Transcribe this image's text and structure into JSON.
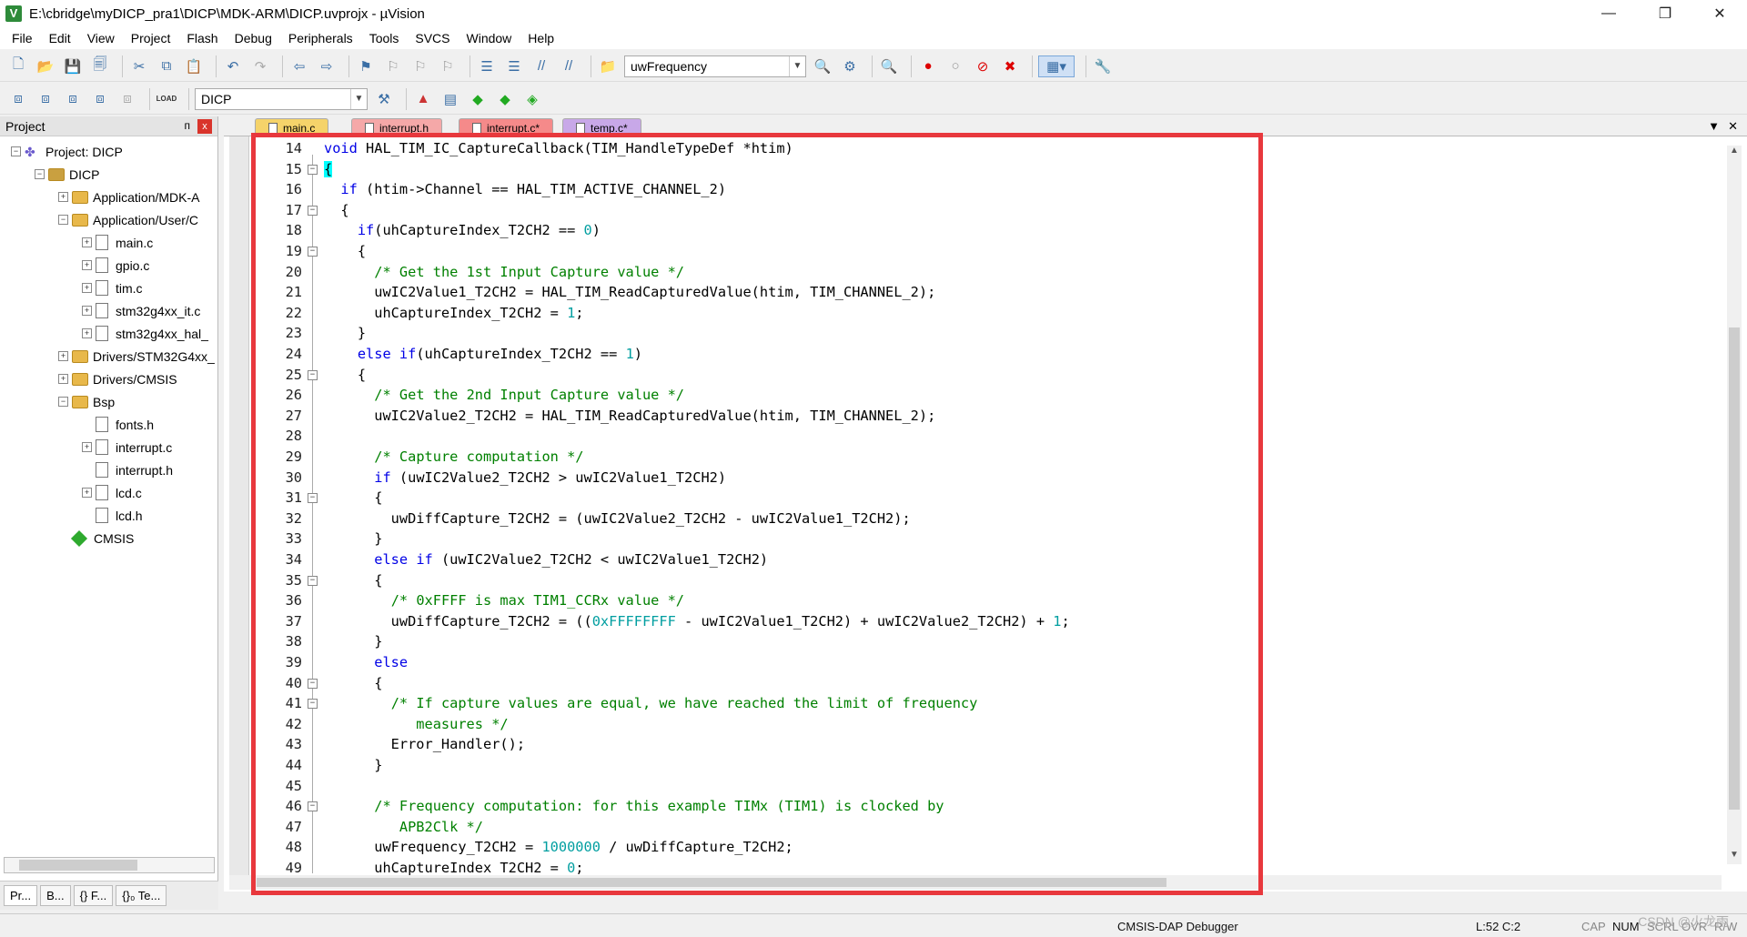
{
  "window": {
    "title": "E:\\cbridge\\myDICP_pra1\\DICP\\MDK-ARM\\DICP.uvprojx - µVision",
    "app_icon": "V",
    "controls": {
      "minimize": "—",
      "maximize": "❐",
      "close": "✕"
    }
  },
  "menu": [
    "File",
    "Edit",
    "View",
    "Project",
    "Flash",
    "Debug",
    "Peripherals",
    "Tools",
    "SVCS",
    "Window",
    "Help"
  ],
  "toolbar1": {
    "find_combo_value": "uwFrequency",
    "icons": [
      "new-file-icon",
      "open-icon",
      "save-icon",
      "save-all-icon",
      "cut-icon",
      "copy-icon",
      "paste-icon",
      "undo-icon",
      "redo-icon",
      "nav-back-icon",
      "nav-forward-icon",
      "bookmark-icon",
      "bookmark-prev-icon",
      "bookmark-next-icon",
      "bookmark-clear-icon",
      "indent-icon",
      "unindent-icon",
      "comment-icon",
      "uncomment-icon",
      "find-in-files-icon"
    ]
  },
  "toolbar2": {
    "target_combo_value": "DICP",
    "load_label": "LOAD"
  },
  "project_panel": {
    "title": "Project",
    "pin": "ᴨ",
    "close": "x",
    "tree": [
      {
        "label": "Project: DICP",
        "level": 0,
        "type": "project",
        "expander": "−"
      },
      {
        "label": "DICP",
        "level": 1,
        "type": "target",
        "expander": "−"
      },
      {
        "label": "Application/MDK-A",
        "level": 2,
        "type": "folder",
        "expander": "+"
      },
      {
        "label": "Application/User/C",
        "level": 2,
        "type": "folder",
        "expander": "−"
      },
      {
        "label": "main.c",
        "level": 3,
        "type": "file",
        "expander": "+"
      },
      {
        "label": "gpio.c",
        "level": 3,
        "type": "file",
        "expander": "+"
      },
      {
        "label": "tim.c",
        "level": 3,
        "type": "file",
        "expander": "+"
      },
      {
        "label": "stm32g4xx_it.c",
        "level": 3,
        "type": "file",
        "expander": "+"
      },
      {
        "label": "stm32g4xx_hal_",
        "level": 3,
        "type": "file",
        "expander": "+"
      },
      {
        "label": "Drivers/STM32G4xx_",
        "level": 2,
        "type": "folder",
        "expander": "+"
      },
      {
        "label": "Drivers/CMSIS",
        "level": 2,
        "type": "folder",
        "expander": "+"
      },
      {
        "label": "Bsp",
        "level": 2,
        "type": "folder",
        "expander": "−"
      },
      {
        "label": "fonts.h",
        "level": 3,
        "type": "file",
        "expander": ""
      },
      {
        "label": "interrupt.c",
        "level": 3,
        "type": "file",
        "expander": "+"
      },
      {
        "label": "interrupt.h",
        "level": 3,
        "type": "file",
        "expander": ""
      },
      {
        "label": "lcd.c",
        "level": 3,
        "type": "file",
        "expander": "+"
      },
      {
        "label": "lcd.h",
        "level": 3,
        "type": "file",
        "expander": ""
      },
      {
        "label": "CMSIS",
        "level": 2,
        "type": "cmsis",
        "expander": ""
      }
    ],
    "bottom_tabs": [
      "Pr...",
      "B...",
      "{} F...",
      "{}₀ Te..."
    ]
  },
  "editor_tabs": [
    {
      "label": "main.c",
      "color": "#f5d36a"
    },
    {
      "label": "interrupt.h",
      "color": "#f5a8a8"
    },
    {
      "label": "interrupt.c*",
      "color": "#f58a8a"
    },
    {
      "label": "temp.c*",
      "color": "#c8a8e8"
    }
  ],
  "code_lines": [
    {
      "n": "14",
      "fold": "",
      "html": "<span class=\"kw\">void</span> HAL_TIM_IC_CaptureCallback(TIM_HandleTypeDef *htim)"
    },
    {
      "n": "15",
      "fold": "−",
      "html": "<span class=\"brace-hl\">{</span>"
    },
    {
      "n": "16",
      "fold": "",
      "html": "  <span class=\"kw\">if</span> (htim->Channel == HAL_TIM_ACTIVE_CHANNEL_2)"
    },
    {
      "n": "17",
      "fold": "−",
      "html": "  {"
    },
    {
      "n": "18",
      "fold": "",
      "html": "    <span class=\"kw\">if</span>(uhCaptureIndex_T2CH2 == <span class=\"num\">0</span>)"
    },
    {
      "n": "19",
      "fold": "−",
      "html": "    {"
    },
    {
      "n": "20",
      "fold": "",
      "html": "      <span class=\"cm\">/* Get the 1st Input Capture value */</span>"
    },
    {
      "n": "21",
      "fold": "",
      "html": "      uwIC2Value1_T2CH2 = HAL_TIM_ReadCapturedValue(htim, TIM_CHANNEL_2);"
    },
    {
      "n": "22",
      "fold": "",
      "html": "      uhCaptureIndex_T2CH2 = <span class=\"num\">1</span>;"
    },
    {
      "n": "23",
      "fold": "",
      "html": "    }"
    },
    {
      "n": "24",
      "fold": "",
      "html": "    <span class=\"kw\">else if</span>(uhCaptureIndex_T2CH2 == <span class=\"num\">1</span>)"
    },
    {
      "n": "25",
      "fold": "−",
      "html": "    {"
    },
    {
      "n": "26",
      "fold": "",
      "html": "      <span class=\"cm\">/* Get the 2nd Input Capture value */</span>"
    },
    {
      "n": "27",
      "fold": "",
      "html": "      uwIC2Value2_T2CH2 = HAL_TIM_ReadCapturedValue(htim, TIM_CHANNEL_2);"
    },
    {
      "n": "28",
      "fold": "",
      "html": ""
    },
    {
      "n": "29",
      "fold": "",
      "html": "      <span class=\"cm\">/* Capture computation */</span>"
    },
    {
      "n": "30",
      "fold": "",
      "html": "      <span class=\"kw\">if</span> (uwIC2Value2_T2CH2 > uwIC2Value1_T2CH2)"
    },
    {
      "n": "31",
      "fold": "−",
      "html": "      {"
    },
    {
      "n": "32",
      "fold": "",
      "html": "        uwDiffCapture_T2CH2 = (uwIC2Value2_T2CH2 - uwIC2Value1_T2CH2);"
    },
    {
      "n": "33",
      "fold": "",
      "html": "      }"
    },
    {
      "n": "34",
      "fold": "",
      "html": "      <span class=\"kw\">else if</span> (uwIC2Value2_T2CH2 < uwIC2Value1_T2CH2)"
    },
    {
      "n": "35",
      "fold": "−",
      "html": "      {"
    },
    {
      "n": "36",
      "fold": "",
      "html": "        <span class=\"cm\">/* 0xFFFF is max TIM1_CCRx value */</span>"
    },
    {
      "n": "37",
      "fold": "",
      "html": "        uwDiffCapture_T2CH2 = ((<span class=\"num\">0xFFFFFFFF</span> - uwIC2Value1_T2CH2) + uwIC2Value2_T2CH2) + <span class=\"num\">1</span>;"
    },
    {
      "n": "38",
      "fold": "",
      "html": "      }"
    },
    {
      "n": "39",
      "fold": "",
      "html": "      <span class=\"kw\">else</span>"
    },
    {
      "n": "40",
      "fold": "−",
      "html": "      {"
    },
    {
      "n": "41",
      "fold": "−",
      "html": "        <span class=\"cm\">/* If capture values are equal, we have reached the limit of frequency</span>"
    },
    {
      "n": "42",
      "fold": "",
      "html": "<span class=\"cm\">           measures */</span>"
    },
    {
      "n": "43",
      "fold": "",
      "html": "        Error_Handler();"
    },
    {
      "n": "44",
      "fold": "",
      "html": "      }"
    },
    {
      "n": "45",
      "fold": "",
      "html": ""
    },
    {
      "n": "46",
      "fold": "−",
      "html": "      <span class=\"cm\">/* Frequency computation: for this example TIMx (TIM1) is clocked by</span>"
    },
    {
      "n": "47",
      "fold": "",
      "html": "<span class=\"cm\">         APB2Clk */</span>"
    },
    {
      "n": "48",
      "fold": "",
      "html": "      uwFrequency_T2CH2 = <span class=\"num\">1000000</span> / uwDiffCapture_T2CH2;"
    },
    {
      "n": "49",
      "fold": "",
      "html": "      uhCaptureIndex_T2CH2 = <span class=\"num\">0</span>;"
    }
  ],
  "status": {
    "debugger": "CMSIS-DAP Debugger",
    "position": "L:52 C:2",
    "cap": "CAP",
    "num": "NUM",
    "scrl": "SCRL",
    "ovr": "OVR",
    "rw": "R/W"
  },
  "watermark": "CSDN @火龙雨",
  "colors": {
    "highlight_border": "#e8383d",
    "keyword": "#0000e6",
    "comment": "#008000",
    "number": "#009ea0"
  }
}
